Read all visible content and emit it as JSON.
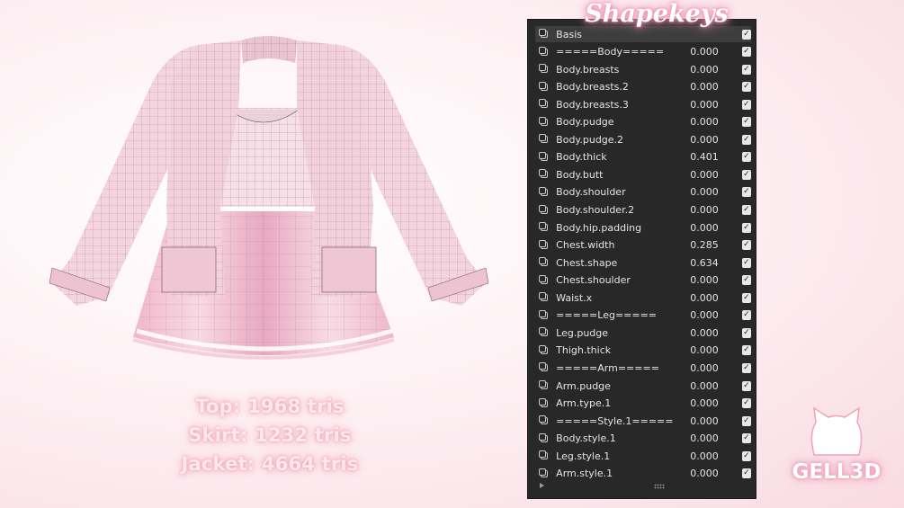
{
  "title": "Shapekeys",
  "tri_counts": [
    "Top: 1968 tris",
    "Skirt: 1232 tris",
    "Jacket: 4664 tris"
  ],
  "shapekeys": [
    {
      "name": "Basis",
      "value": "",
      "enabled": true,
      "active": true
    },
    {
      "name": "=====Body=====",
      "value": "0.000",
      "enabled": true
    },
    {
      "name": "Body.breasts",
      "value": "0.000",
      "enabled": true
    },
    {
      "name": "Body.breasts.2",
      "value": "0.000",
      "enabled": true
    },
    {
      "name": "Body.breasts.3",
      "value": "0.000",
      "enabled": true
    },
    {
      "name": "Body.pudge",
      "value": "0.000",
      "enabled": true
    },
    {
      "name": "Body.pudge.2",
      "value": "0.000",
      "enabled": true
    },
    {
      "name": "Body.thick",
      "value": "0.401",
      "enabled": true
    },
    {
      "name": "Body.butt",
      "value": "0.000",
      "enabled": true
    },
    {
      "name": "Body.shoulder",
      "value": "0.000",
      "enabled": true
    },
    {
      "name": "Body.shoulder.2",
      "value": "0.000",
      "enabled": true
    },
    {
      "name": "Body.hip.padding",
      "value": "0.000",
      "enabled": true
    },
    {
      "name": "Chest.width",
      "value": "0.285",
      "enabled": true
    },
    {
      "name": "Chest.shape",
      "value": "0.634",
      "enabled": true
    },
    {
      "name": "Chest.shoulder",
      "value": "0.000",
      "enabled": true
    },
    {
      "name": "Waist.x",
      "value": "0.000",
      "enabled": true
    },
    {
      "name": "=====Leg=====",
      "value": "0.000",
      "enabled": true
    },
    {
      "name": "Leg.pudge",
      "value": "0.000",
      "enabled": true
    },
    {
      "name": "Thigh.thick",
      "value": "0.000",
      "enabled": true
    },
    {
      "name": "=====Arm=====",
      "value": "0.000",
      "enabled": true
    },
    {
      "name": "Arm.pudge",
      "value": "0.000",
      "enabled": true
    },
    {
      "name": "Arm.type.1",
      "value": "0.000",
      "enabled": true
    },
    {
      "name": "=====Style.1=====",
      "value": "0.000",
      "enabled": true
    },
    {
      "name": "Body.style.1",
      "value": "0.000",
      "enabled": true
    },
    {
      "name": "Leg.style.1",
      "value": "0.000",
      "enabled": true
    },
    {
      "name": "Arm.style.1",
      "value": "0.000",
      "enabled": true
    }
  ],
  "logo": {
    "text": "GELL3D",
    "icon": "cat-head-icon"
  },
  "colors": {
    "outfit_pink": "#f3c9d6",
    "panel_bg": "#282828",
    "glow_pink": "#ef8daf"
  }
}
